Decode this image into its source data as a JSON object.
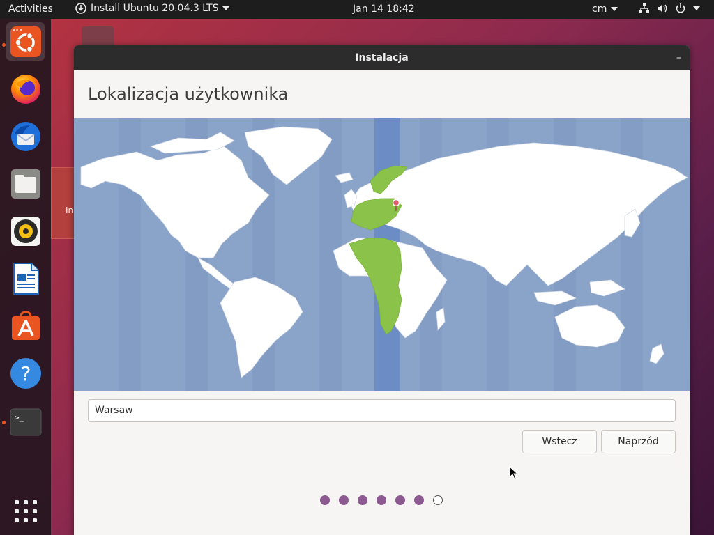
{
  "topbar": {
    "activities": "Activities",
    "app_menu": "Install Ubuntu 20.04.3 LTS",
    "clock": "Jan 14  18:42",
    "keyboard_layout": "cm"
  },
  "dock": {
    "items": [
      {
        "name": "ubuntu-installer",
        "icon": "ubuntu-logo-icon",
        "active": true,
        "running": true
      },
      {
        "name": "firefox",
        "icon": "firefox-icon"
      },
      {
        "name": "thunderbird",
        "icon": "thunderbird-icon"
      },
      {
        "name": "files",
        "icon": "files-icon"
      },
      {
        "name": "rhythmbox",
        "icon": "rhythmbox-icon"
      },
      {
        "name": "libreoffice-writer",
        "icon": "writer-icon"
      },
      {
        "name": "ubuntu-software",
        "icon": "software-icon"
      },
      {
        "name": "help",
        "icon": "help-icon"
      },
      {
        "name": "terminal",
        "icon": "terminal-icon",
        "running": true
      },
      {
        "name": "show-applications",
        "icon": "app-grid-icon"
      }
    ]
  },
  "desktop": {
    "installer_label_fragment": "In"
  },
  "window": {
    "title": "Instalacja",
    "minimize": "–",
    "heading": "Lokalizacja użytkownika",
    "location_value": "Warsaw",
    "back_label": "Wstecz",
    "next_label": "Naprzód",
    "progress": {
      "total": 7,
      "completed": 6
    }
  },
  "map": {
    "selected_city": "Warsaw",
    "timezone_highlight_color": "#6b8cc4",
    "zone_color": "#8bc34a",
    "land_color": "#ffffff",
    "ocean_color": "#8aa3c9"
  },
  "colors": {
    "accent": "#e95420",
    "progress_done": "#8c5a91"
  }
}
